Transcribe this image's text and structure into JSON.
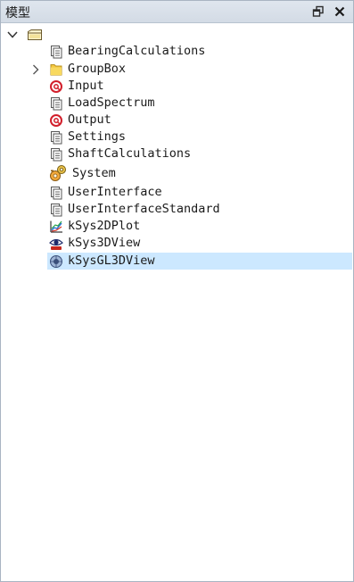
{
  "panel": {
    "title": "模型",
    "restore_icon": "restore-window-icon",
    "close_icon": "close-icon"
  },
  "tree": {
    "root": {
      "expanded": true,
      "icon": "folder-box-icon",
      "label": ""
    },
    "items": [
      {
        "label": "BearingCalculations",
        "icon": "module-pages-icon",
        "expandable": false
      },
      {
        "label": "GroupBox",
        "icon": "yellow-folder-icon",
        "expandable": true,
        "expanded": false
      },
      {
        "label": "Input",
        "icon": "red-circle-icon",
        "expandable": false
      },
      {
        "label": "LoadSpectrum",
        "icon": "module-pages-icon",
        "expandable": false
      },
      {
        "label": "Output",
        "icon": "red-circle-icon",
        "expandable": false
      },
      {
        "label": "Settings",
        "icon": "module-pages-icon",
        "expandable": false
      },
      {
        "label": "ShaftCalculations",
        "icon": "module-pages-icon",
        "expandable": false
      },
      {
        "label": "System",
        "icon": "system-gears-icon",
        "expandable": false
      },
      {
        "label": "UserInterface",
        "icon": "module-pages-icon",
        "expandable": false
      },
      {
        "label": "UserInterfaceStandard",
        "icon": "module-pages-icon",
        "expandable": false
      },
      {
        "label": "kSys2DPlot",
        "icon": "plot-2d-icon",
        "expandable": false
      },
      {
        "label": "kSys3DView",
        "icon": "eye-3d-icon",
        "expandable": false
      },
      {
        "label": "kSysGL3DView",
        "icon": "globe-gl-icon",
        "expandable": false,
        "selected": true
      }
    ]
  },
  "colors": {
    "selection": "#cce8ff",
    "titlebar": "#d8e0e9",
    "border": "#a9b4c2"
  }
}
